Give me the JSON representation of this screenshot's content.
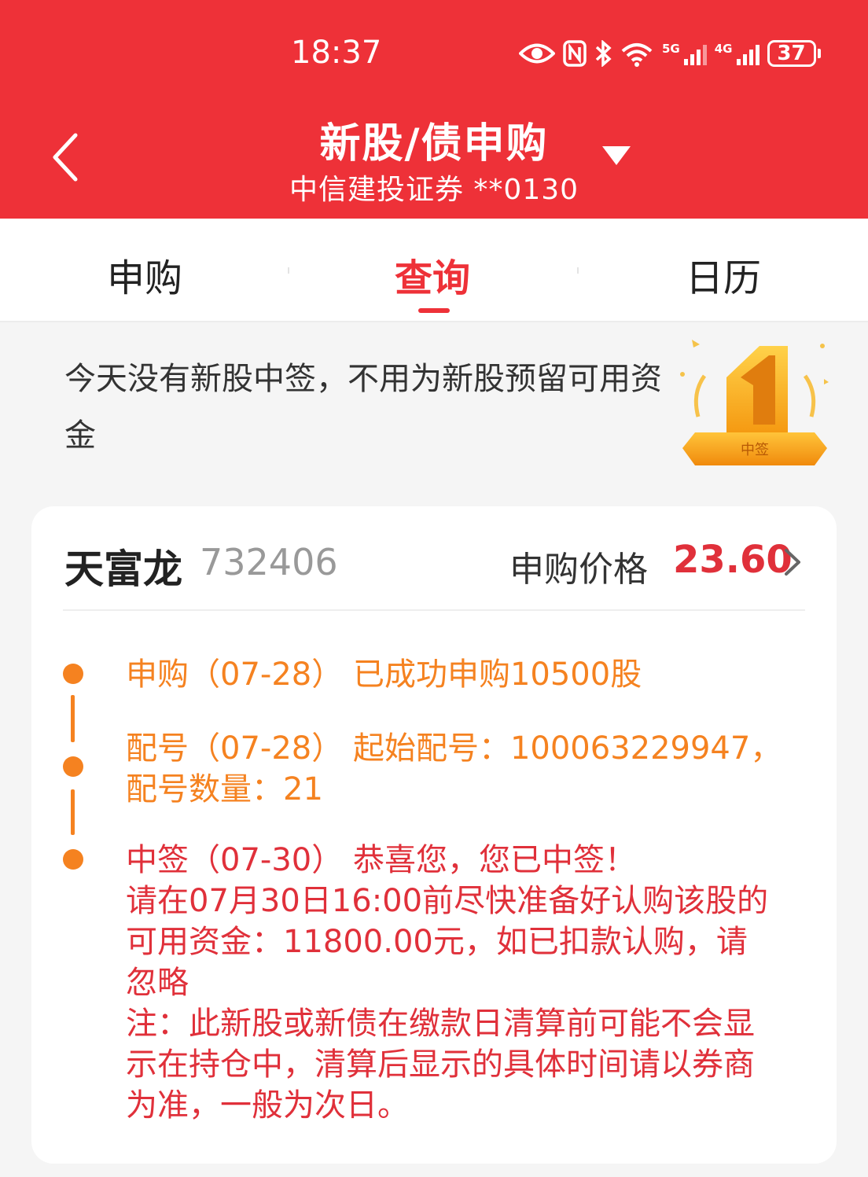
{
  "status_bar": {
    "time": "18:37",
    "battery": "37",
    "icons": [
      "eye-icon",
      "nfc-icon",
      "bluetooth-icon",
      "wifi-icon",
      "5g-signal-icon",
      "4g-signal-icon",
      "battery-icon"
    ],
    "sig1_label": "5G",
    "sig2_label": "4G"
  },
  "nav": {
    "title": "新股/债申购",
    "subtitle": "中信建投证券 **0130"
  },
  "tabs": [
    {
      "label": "申购",
      "active": false
    },
    {
      "label": "查询",
      "active": true
    },
    {
      "label": "日历",
      "active": false
    }
  ],
  "notice": {
    "text": "今天没有新股中签，不用为新股预留可用资金",
    "badge_text": "中签"
  },
  "card": {
    "stock_name": "天富龙",
    "stock_code": "732406",
    "price_label": "申购价格",
    "price_value": "23.60",
    "steps": [
      {
        "text": "申购（07-28） 已成功申购10500股"
      },
      {
        "line1": "配号（07-28） 起始配号：100063229947，",
        "line2": "配号数量：21"
      },
      {
        "line1": "中签（07-30） 恭喜您，您已中签！",
        "line2": "请在07月30日16:00前尽快准备好认购该股的",
        "line3": "可用资金：11800.00元，如已扣款认购，请",
        "line4": "忽略",
        "note1": "注：此新股或新债在缴款日清算前可能不会显",
        "note2": "示在持仓中，清算后显示的具体时间请以券商",
        "note3": "为准，一般为次日。"
      }
    ]
  },
  "colors": {
    "header_red": "#ee3138",
    "price_red": "#e0303a",
    "timeline_orange": "#f58220"
  }
}
